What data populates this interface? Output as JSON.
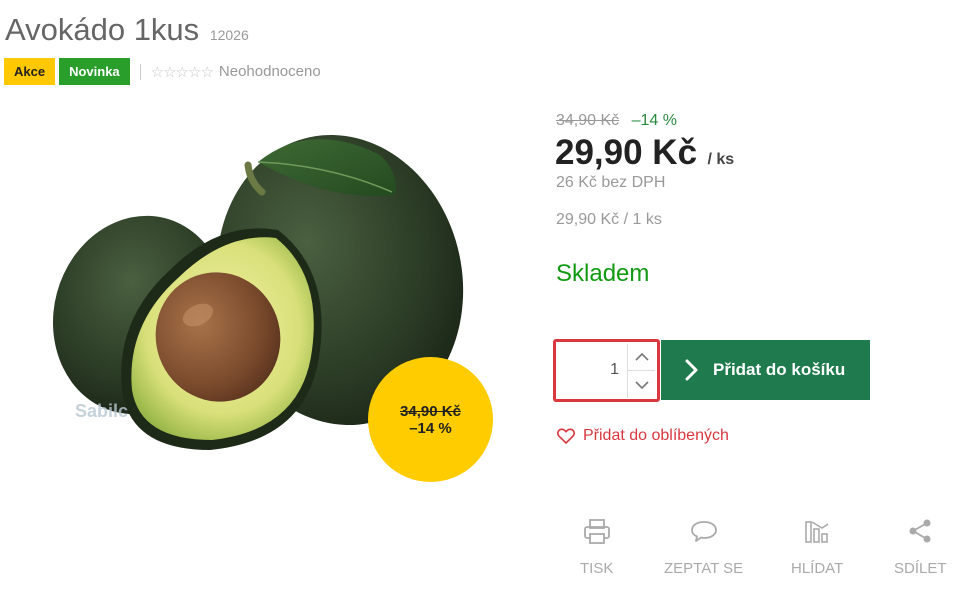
{
  "product": {
    "name": "Avokádo 1kus",
    "code": "12026"
  },
  "badges": {
    "akce": "Akce",
    "novinka": "Novinka"
  },
  "rating": {
    "stars": "☆☆☆☆☆",
    "text": "Neohodnoceno"
  },
  "image": {
    "watermark": "Sabilc"
  },
  "sale_circle": {
    "old_price": "34,90 Kč",
    "percent": "–14 %",
    "color": "#ffcc00"
  },
  "pricing": {
    "old_price": "34,90 Kč",
    "discount": "–14 %",
    "price": "29,90 Kč",
    "unit": "/ ks",
    "without_vat": "26 Kč bez DPH",
    "unit_price": "29,90 Kč / 1 ks"
  },
  "stock": {
    "label": "Skladem",
    "color": "#119911"
  },
  "cart": {
    "quantity": "1",
    "add_label": "Přidat do košíku",
    "button_color": "#1f7a4d",
    "highlight_color": "#d9383f"
  },
  "favorite": {
    "label": "Přidat do oblíbených",
    "icon": "heart-icon"
  },
  "actions": [
    {
      "label": "TISK",
      "icon": "printer-icon"
    },
    {
      "label": "ZEPTAT SE",
      "icon": "speech-bubble-icon"
    },
    {
      "label": "HLÍDAT",
      "icon": "watch-chart-icon"
    },
    {
      "label": "SDÍLET",
      "icon": "share-icon"
    }
  ]
}
